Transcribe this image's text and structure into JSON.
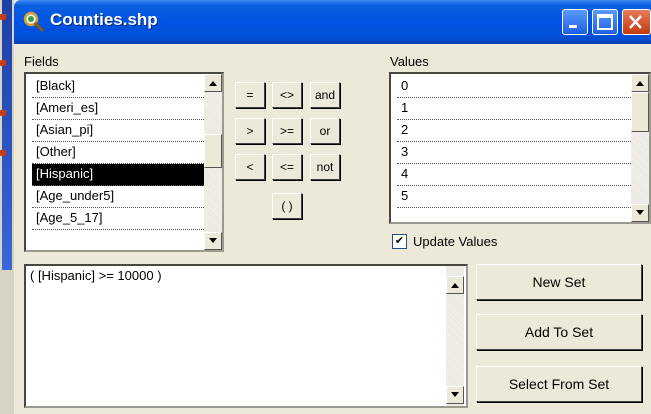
{
  "window": {
    "title": "Counties.shp",
    "title_icon": "query-magnifier-icon"
  },
  "fields": {
    "label": "Fields",
    "items": [
      "[Black]",
      "[Ameri_es]",
      "[Asian_pi]",
      "[Other]",
      "[Hispanic]",
      "[Age_under5]",
      "[Age_5_17]"
    ],
    "selected_index": 4
  },
  "operators": {
    "equals": "=",
    "not_equals": "<>",
    "and": "and",
    "greater": ">",
    "greater_equal": ">=",
    "or": "or",
    "less": "<",
    "less_equal": "<=",
    "not": "not",
    "parens": "( )"
  },
  "values": {
    "label": "Values",
    "items": [
      "0",
      "1",
      "2",
      "3",
      "4",
      "5"
    ],
    "update_values_label": "Update Values",
    "update_values_checked": true
  },
  "query": {
    "text": "( [Hispanic] >= 10000 )"
  },
  "actions": {
    "new_set": "New Set",
    "add_to_set": "Add To Set",
    "select_from_set": "Select From Set"
  }
}
